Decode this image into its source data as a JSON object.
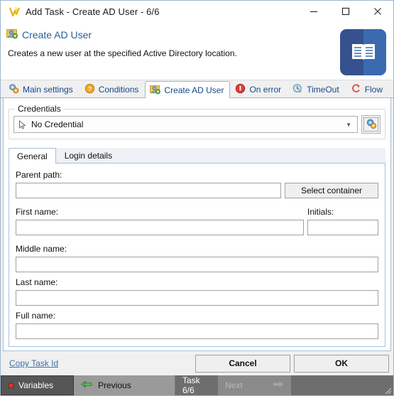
{
  "window": {
    "title": "Add Task - Create AD User - 6/6",
    "app_icon": "vt-logo-icon",
    "controls": {
      "minimize": "minimize-icon",
      "maximize": "maximize-icon",
      "close": "close-icon"
    }
  },
  "header": {
    "icon": "create-ad-user-icon",
    "title": "Create AD User",
    "description": "Creates a new user at the specified Active Directory location.",
    "badge_icon": "documentation-book-icon",
    "title_color": "#2a6099",
    "badge_color": "#35528f"
  },
  "tabs": [
    {
      "label": "Main settings",
      "icon": "gears-icon",
      "active": false
    },
    {
      "label": "Conditions",
      "icon": "question-mark-icon",
      "active": false
    },
    {
      "label": "Create AD User",
      "icon": "create-ad-user-icon",
      "active": true
    },
    {
      "label": "On error",
      "icon": "error-circle-icon",
      "active": false
    },
    {
      "label": "TimeOut",
      "icon": "timeout-clock-icon",
      "active": false
    },
    {
      "label": "Flow",
      "icon": "flow-arrow-icon",
      "active": false
    }
  ],
  "credentials": {
    "legend": "Credentials",
    "combo": {
      "value": "No Credential",
      "icon": "cursor-arrow-icon",
      "dropdown_icon": "chevron-down-icon"
    },
    "settings_button_icon": "gear-settings-icon"
  },
  "inner_tabs": [
    {
      "label": "General",
      "active": true
    },
    {
      "label": "Login details",
      "active": false
    }
  ],
  "form": {
    "parent_path": {
      "label": "Parent path:",
      "value": "",
      "placeholder": ""
    },
    "select_container_button": "Select container",
    "first_name": {
      "label": "First name:",
      "value": "",
      "placeholder": ""
    },
    "initials": {
      "label": "Initials:",
      "value": "",
      "placeholder": ""
    },
    "middle_name": {
      "label": "Middle name:",
      "value": "",
      "placeholder": ""
    },
    "last_name": {
      "label": "Last name:",
      "value": "",
      "placeholder": ""
    },
    "full_name": {
      "label": "Full name:",
      "value": "",
      "placeholder": ""
    }
  },
  "footer": {
    "copy_task_id": "Copy Task Id",
    "cancel": "Cancel",
    "ok": "OK"
  },
  "statusbar": {
    "variables": "Variables",
    "variables_icon": "red-square-icon",
    "previous": "Previous",
    "previous_icon": "arrow-left-icon",
    "task_counter": "Task 6/6",
    "next": "Next",
    "next_icon": "arrow-right-icon",
    "resize_grip": "resize-grip-icon"
  }
}
